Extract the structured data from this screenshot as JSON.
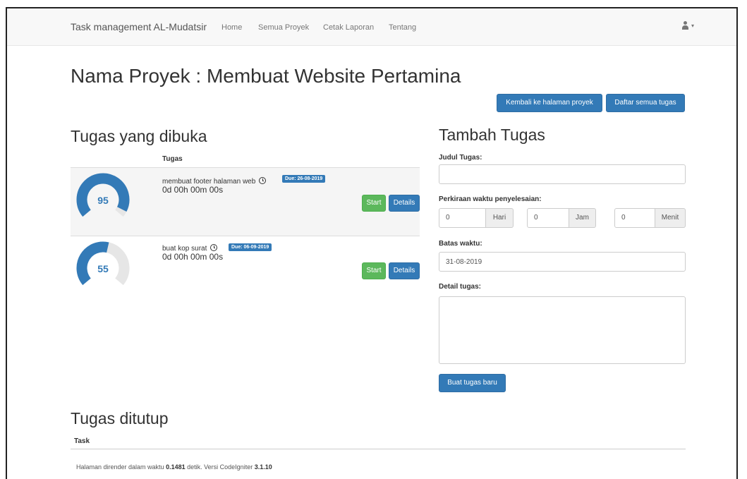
{
  "navbar": {
    "brand": "Task management AL-Mudatsir",
    "links": [
      "Home",
      "Semua Proyek",
      "Cetak Laporan",
      "Tentang"
    ],
    "user_icon": "user-icon",
    "caret": "▾"
  },
  "project": {
    "title": "Nama Proyek : Membuat Website Pertamina",
    "back_button": "Kembali ke halaman proyek",
    "all_tasks_button": "Daftar semua tugas"
  },
  "open_tasks": {
    "heading": "Tugas yang dibuka",
    "column": "Tugas",
    "start_label": "Start",
    "details_label": "Details",
    "items": [
      {
        "title": "membuat footer halaman web",
        "due": "Due: 26-08-2019",
        "timer": "0d 00h 00m 00s",
        "progress": 95
      },
      {
        "title": "buat kop surat",
        "due": "Due: 06-09-2019",
        "timer": "0d 00h 00m 00s",
        "progress": 55
      }
    ]
  },
  "add_task": {
    "heading": "Tambah Tugas",
    "title_label": "Judul Tugas:",
    "title_value": "",
    "estimate_label": "Perkiraan waktu penyelesaian:",
    "days_value": "0",
    "days_unit": "Hari",
    "hours_value": "0",
    "hours_unit": "Jam",
    "minutes_value": "0",
    "minutes_unit": "Menit",
    "deadline_label": "Batas waktu:",
    "deadline_value": "31-08-2019",
    "detail_label": "Detail tugas:",
    "detail_value": "",
    "submit_label": "Buat tugas baru"
  },
  "closed_tasks": {
    "heading": "Tugas ditutup",
    "column": "Task"
  },
  "footer": {
    "prefix": "Halaman dirender dalam waktu",
    "time": "0.1481",
    "middle": "detik. Versi CodeIgniter",
    "version": "3.1.10"
  },
  "colors": {
    "primary": "#337ab7",
    "success": "#5cb85c",
    "gauge_track": "#e6e6e6"
  }
}
